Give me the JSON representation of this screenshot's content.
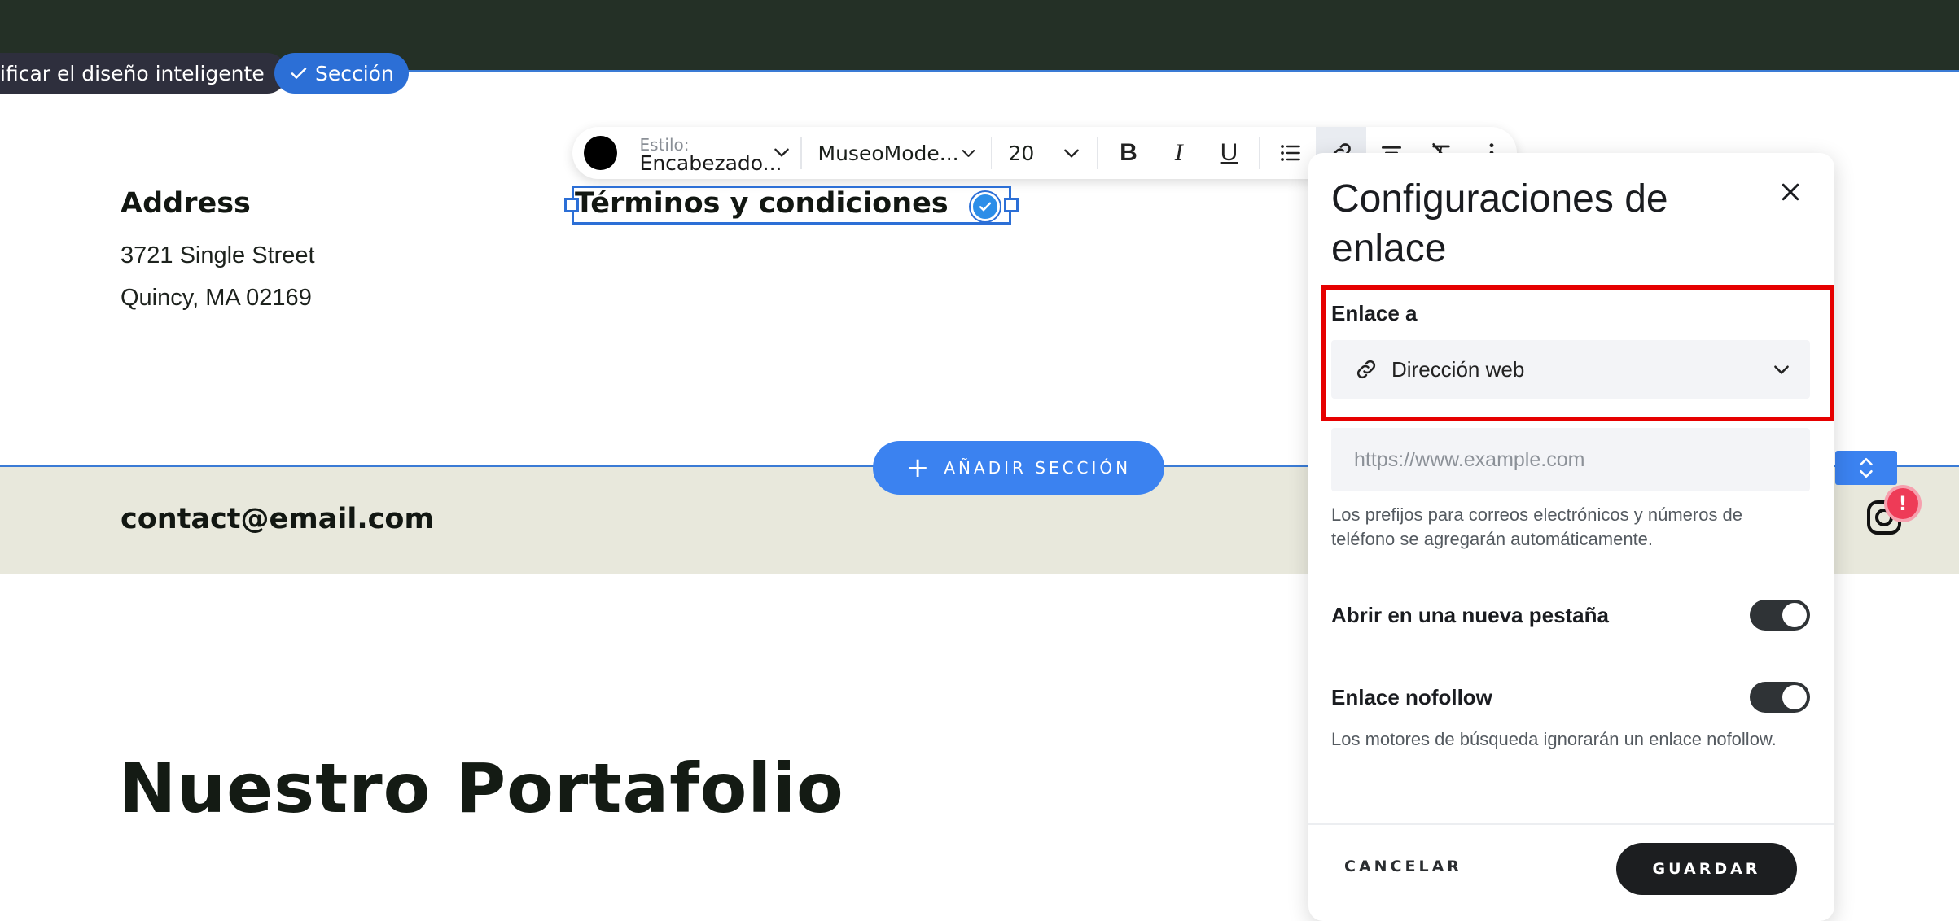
{
  "header": {
    "smart_layout_label": "ificar el diseño inteligente",
    "section_label": "Sección"
  },
  "toolbar": {
    "color": "#000000",
    "style_label": "Estilo:",
    "style_value": "Encabezado...",
    "font_value": "MuseoMode...",
    "size_value": "20",
    "bold": "B",
    "italic": "I",
    "underline": "U"
  },
  "content": {
    "address_title": "Address",
    "address_line1": "3721 Single Street",
    "address_line2": "Quincy, MA 02169",
    "terms_text": "Términos y condiciones",
    "contact_email": "contact@email.com",
    "add_section_label": "AÑADIR SECCIÓN",
    "portfolio_title": "Nuestro Portafolio",
    "alert_badge": "!"
  },
  "panel": {
    "title": "Configuraciones de enlace",
    "link_to_label": "Enlace a",
    "link_type_value": "Dirección web",
    "url_placeholder": "https://www.example.com",
    "url_value": "",
    "prefix_help": "Los prefijos para correos electrónicos y números de teléfono se agregarán automáticamente.",
    "new_tab_label": "Abrir en una nueva pestaña",
    "new_tab_on": true,
    "nofollow_label": "Enlace nofollow",
    "nofollow_on": true,
    "nofollow_help": "Los motores de búsqueda ignorarán un enlace nofollow.",
    "cancel_label": "CANCELAR",
    "save_label": "GUARDAR"
  },
  "colors": {
    "topbar": "#243026",
    "accent_blue": "#3b82f0",
    "footer_band": "#e8e8dc",
    "highlight_red": "#e60000"
  }
}
